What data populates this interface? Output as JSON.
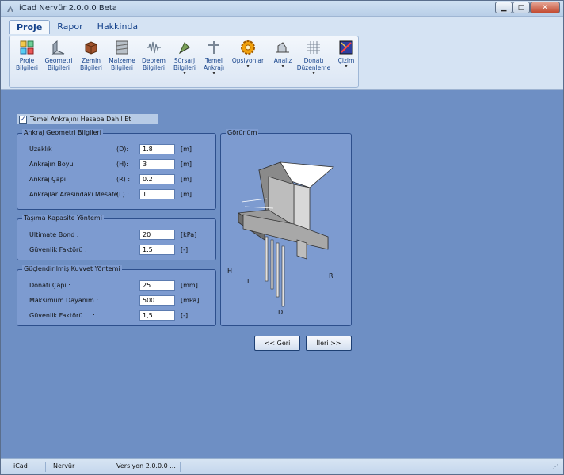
{
  "window": {
    "title": "iCad Nervür 2.0.0.0 Beta"
  },
  "ribbon": {
    "tabs": [
      {
        "label": "Proje",
        "active": true
      },
      {
        "label": "Rapor",
        "active": false
      },
      {
        "label": "Hakkinda",
        "active": false
      }
    ],
    "buttons": [
      {
        "label": "Proje\nBilgileri",
        "icon": "project-info-icon"
      },
      {
        "label": "Geometri\nBilgileri",
        "icon": "geometry-icon"
      },
      {
        "label": "Zemin\nBilgileri",
        "icon": "soil-icon"
      },
      {
        "label": "Malzeme\nBilgileri",
        "icon": "material-icon"
      },
      {
        "label": "Deprem\nBilgileri",
        "icon": "earthquake-icon"
      },
      {
        "label": "Sürsarj\nBilgileri",
        "icon": "surcharge-icon"
      },
      {
        "label": "Temel\nAnkrajı",
        "icon": "anchor-icon"
      },
      {
        "label": "Opsiyonlar",
        "icon": "options-gear-icon"
      },
      {
        "label": "Analiz",
        "icon": "analysis-icon"
      },
      {
        "label": "Donatı\nDüzenleme",
        "icon": "rebar-icon"
      },
      {
        "label": "Çizim",
        "icon": "drawing-icon"
      }
    ]
  },
  "form": {
    "include_checkbox": {
      "label": "Temel Ankrajını Hesaba Dahil Et",
      "checked": true
    },
    "geometry": {
      "title": "Ankraj Geometri  Bilgileri",
      "rows": [
        {
          "label": "Uzaklık",
          "symbol": "(D):",
          "value": "1.8",
          "unit": "[m]"
        },
        {
          "label": "Ankrajın Boyu",
          "symbol": "(H):",
          "value": "3",
          "unit": "[m]"
        },
        {
          "label": "Ankraj Çapı",
          "symbol": "(R) :",
          "value": "0.2",
          "unit": "[m]"
        },
        {
          "label": "Ankrajlar Arasındaki Mesafe",
          "symbol": "(L) :",
          "value": "1",
          "unit": "[m]"
        }
      ]
    },
    "capacity": {
      "title": "Taşıma Kapasite Yöntemi",
      "rows": [
        {
          "label": "Ultimate Bond :",
          "value": "20",
          "unit": "[kPa]"
        },
        {
          "label": "Güvenlik Faktörü :",
          "value": "1.5",
          "unit": "[-]"
        }
      ]
    },
    "reinforced": {
      "title": "Güçlendirilmiş Kuvvet Yöntemi",
      "rows": [
        {
          "label": "Donatı Çapı :",
          "value": "25",
          "unit": "[mm]"
        },
        {
          "label": "Maksimum Dayanım :",
          "value": "500",
          "unit": "[mPa]"
        },
        {
          "label": "Güvenlik Faktörü     :",
          "value": "1,5",
          "unit": "[-]"
        }
      ]
    },
    "preview": {
      "title": "Görünüm",
      "labels": {
        "h": "H",
        "l": "L",
        "r": "R",
        "d": "D"
      }
    },
    "buttons": {
      "back": "<< Geri",
      "next": "İleri >>"
    }
  },
  "statusbar": {
    "app": "iCad",
    "module": "Nervür",
    "version": "Versiyon 2.0.0.0 ..."
  }
}
